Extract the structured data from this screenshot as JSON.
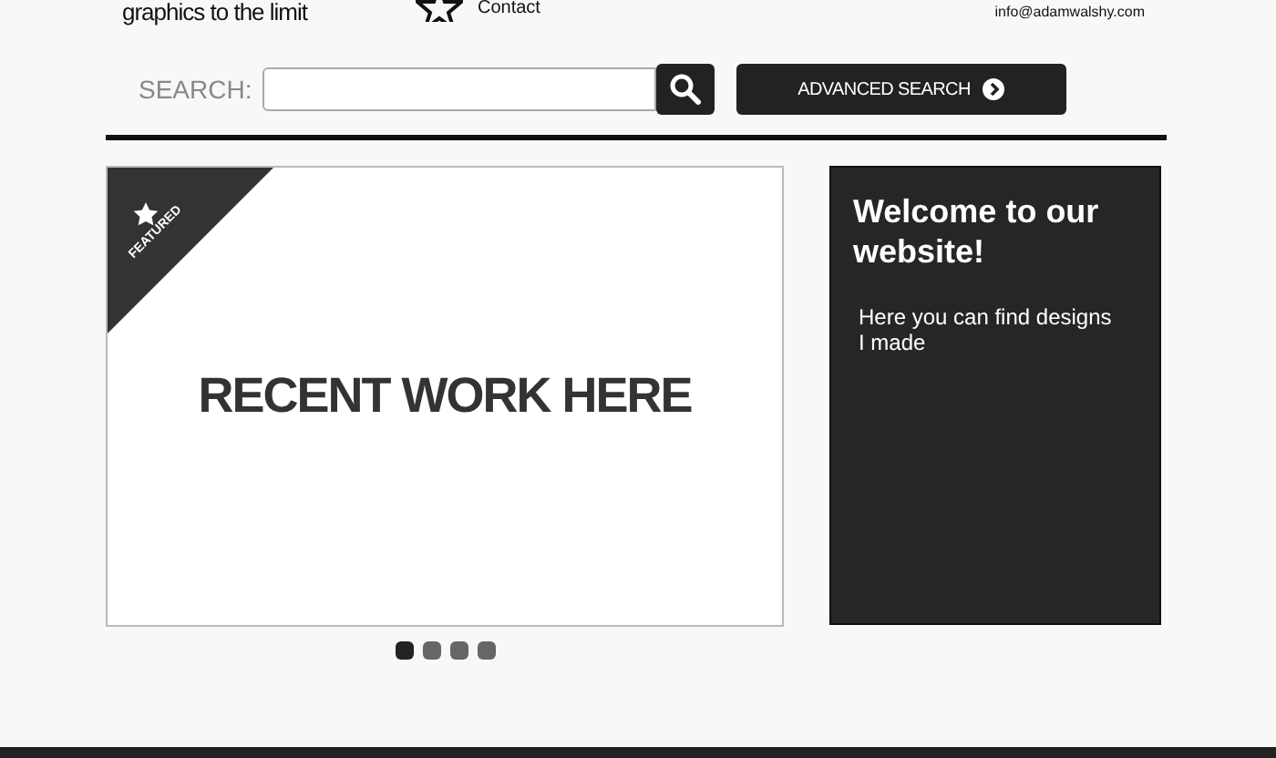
{
  "header": {
    "tagline": "graphics to the limit",
    "nav_link": "Contact",
    "email": "info@adamwalshy.com"
  },
  "search": {
    "label": "SEARCH:",
    "advanced_button": "ADVANCED SEARCH"
  },
  "slideshow": {
    "badge": "FEATURED",
    "headline": "RECENT WORK HERE",
    "dots": [
      {
        "selected": true
      },
      {
        "selected": false
      },
      {
        "selected": false
      },
      {
        "selected": false
      }
    ]
  },
  "welcome": {
    "title": "Welcome to our website!",
    "text": "Here you can find designs I made"
  }
}
